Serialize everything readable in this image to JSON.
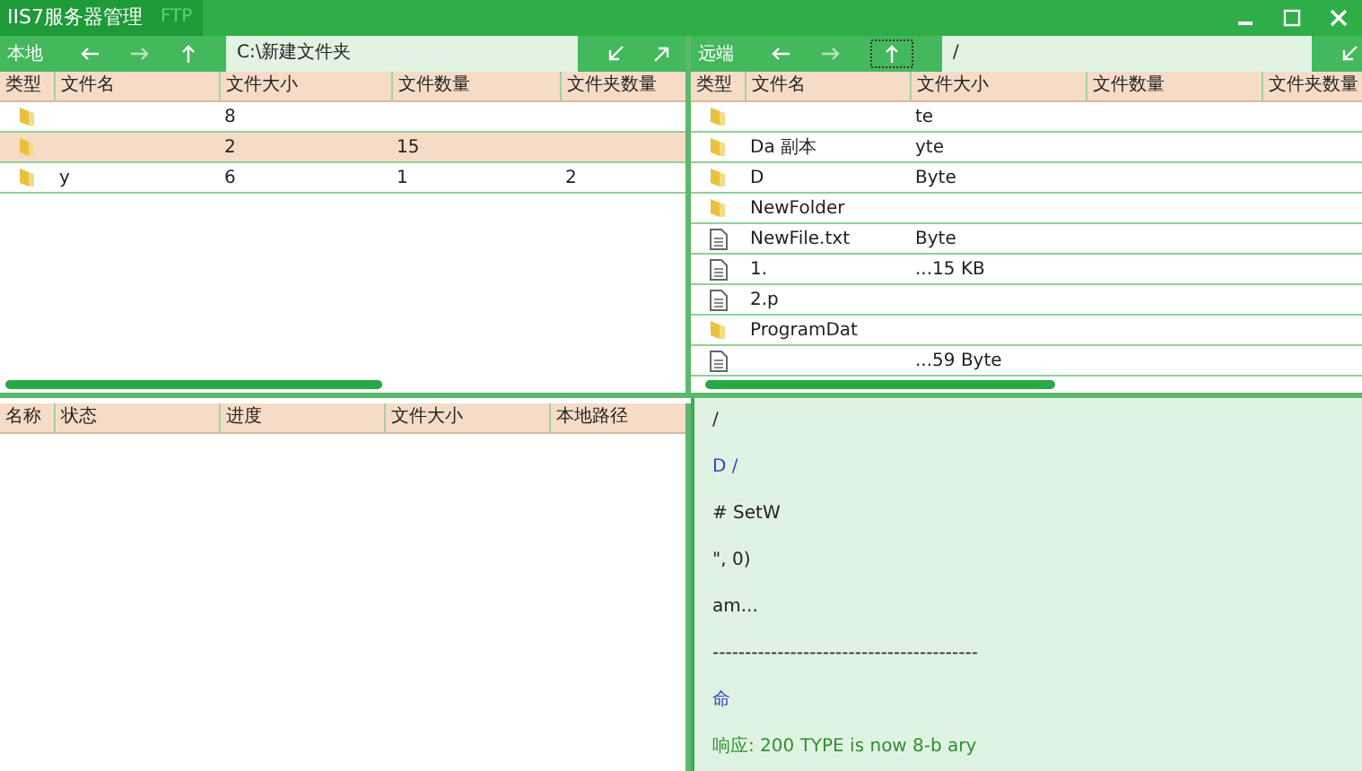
{
  "window": {
    "title": "IIS7服务器管理",
    "subtitle": "FTP"
  },
  "local": {
    "label": "本地",
    "path": "C:\\新建文件夹",
    "columns": [
      "类型",
      "文件名",
      "文件大小",
      "文件数量",
      "文件夹数量"
    ],
    "rows": [
      {
        "kind": "folder",
        "name": "",
        "size": "8",
        "files": "",
        "folders": "",
        "selected": false
      },
      {
        "kind": "folder",
        "name": "",
        "size": "2",
        "files": "15",
        "folders": "",
        "selected": true
      },
      {
        "kind": "folder",
        "name": "y",
        "size": "6",
        "files": "1",
        "folders": "2",
        "selected": false
      }
    ]
  },
  "remote": {
    "label": "远端",
    "path": "/",
    "columns": [
      "类型",
      "文件名",
      "文件大小",
      "文件数量",
      "文件夹数量"
    ],
    "rows": [
      {
        "kind": "folder",
        "name": "",
        "size": "te",
        "selected": false
      },
      {
        "kind": "folder",
        "name": "Da 副本",
        "size": "yte",
        "selected": false
      },
      {
        "kind": "folder",
        "name": "D",
        "size": "Byte",
        "selected": false
      },
      {
        "kind": "folder",
        "name": "NewFolder",
        "size": "",
        "selected": false
      },
      {
        "kind": "file",
        "name": "NewFile.txt",
        "size": "Byte",
        "selected": false
      },
      {
        "kind": "file",
        "name": "1.",
        "size": "...15 KB",
        "selected": false
      },
      {
        "kind": "file",
        "name": "2.p",
        "size": "",
        "selected": false
      },
      {
        "kind": "folder",
        "name": "ProgramDat",
        "size": "",
        "selected": false
      },
      {
        "kind": "file",
        "name": "",
        "size": "...59 Byte",
        "selected": false
      }
    ]
  },
  "transfers": {
    "columns": [
      "名称",
      "状态",
      "进度",
      "文件大小",
      "本地路径"
    ]
  },
  "log": [
    {
      "kind": "info",
      "text": "/"
    },
    {
      "kind": "command",
      "text": "D /"
    },
    {
      "kind": "info",
      "text": "# SetW"
    },
    {
      "kind": "info",
      "text": "\", 0)"
    },
    {
      "kind": "info",
      "text": "am..."
    },
    {
      "kind": "info",
      "text": "-----------------------------------------"
    },
    {
      "kind": "command",
      "text": "命"
    },
    {
      "kind": "response",
      "text": "响应: 200 TYPE is now 8-b ary"
    }
  ]
}
